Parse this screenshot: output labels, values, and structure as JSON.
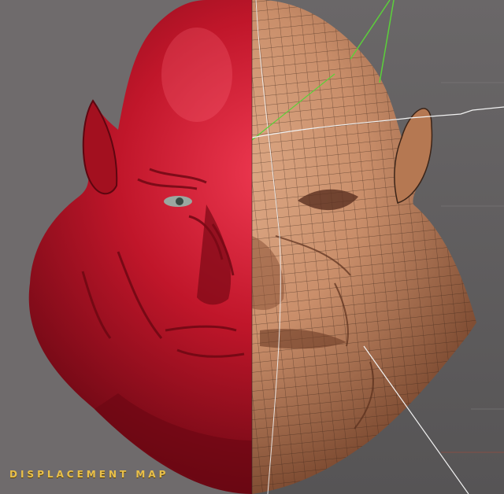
{
  "caption": "DISPLACEMENT MAP",
  "colors": {
    "left_background": "#6f6b6c",
    "right_background": "#5d5b5c",
    "sculpt_red": "#c0162a",
    "sculpt_dark_red": "#5e0610",
    "skin": "#c98e6a",
    "skin_dark": "#6b3b24",
    "wire": "#3b2418",
    "caption_gold": "#e9c04a",
    "guide_green": "#5bd13a",
    "guide_white": "#f2f2f2"
  },
  "panels": {
    "left": "displacement-sculpt-render",
    "right": "base-mesh-wireframe"
  }
}
